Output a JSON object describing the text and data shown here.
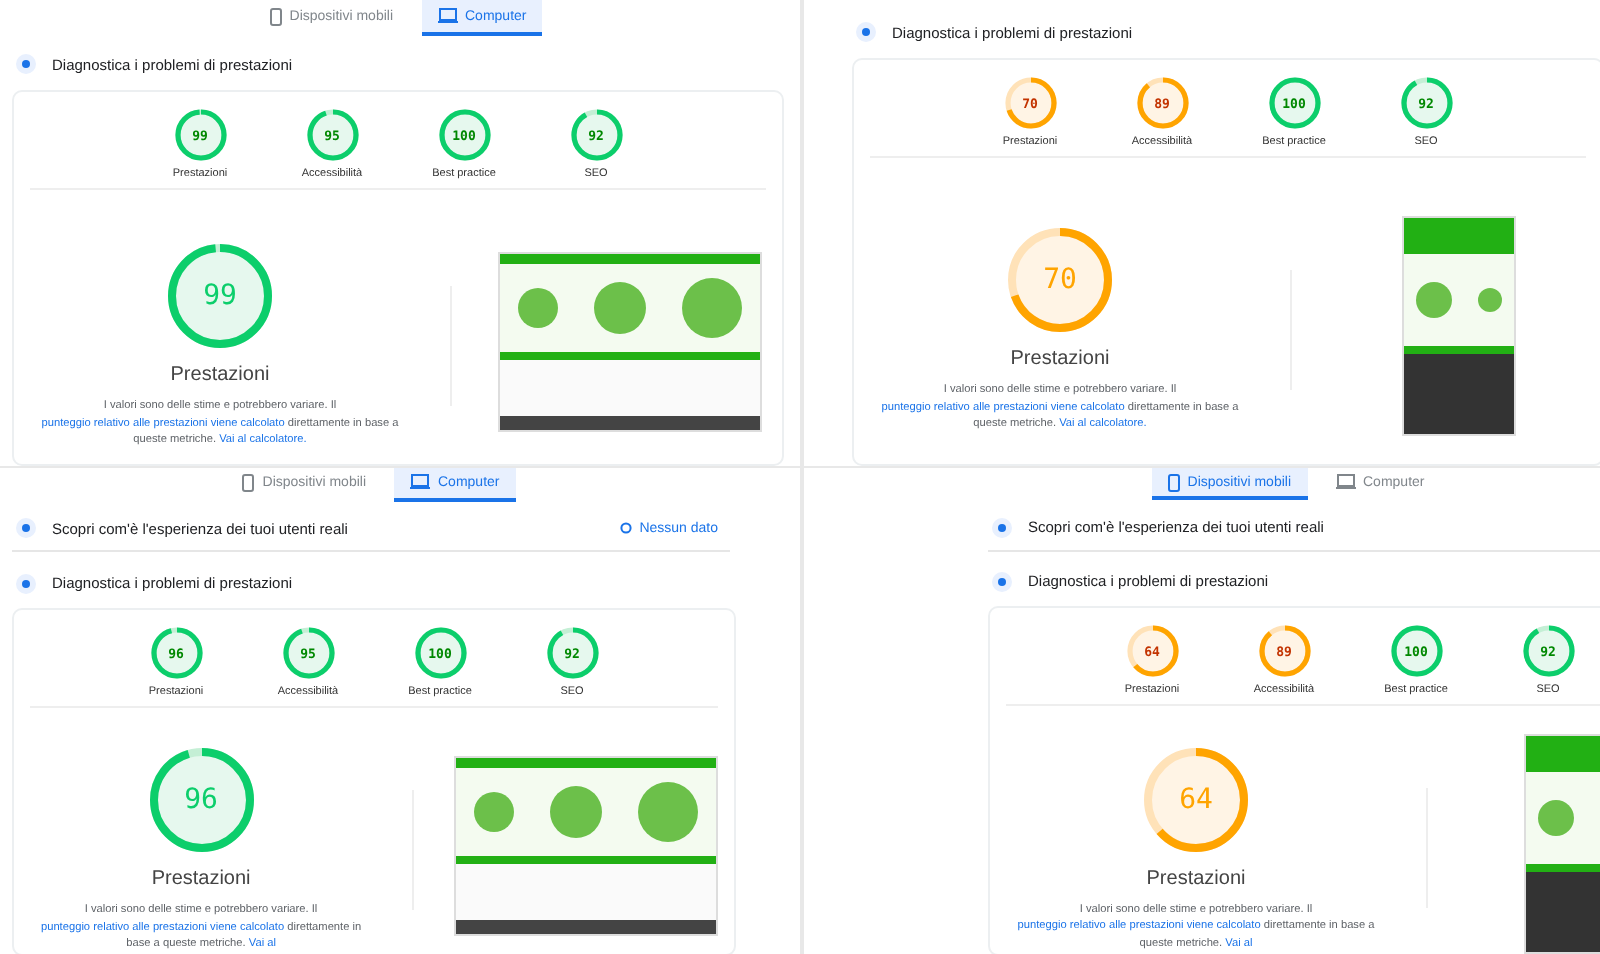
{
  "panels": [
    {
      "preview": {
        "kind": "desktop"
      },
      "tabs": [
        {
          "label": "Dispositivi mobili",
          "kind": "mobile",
          "selected": false
        },
        {
          "label": "Computer",
          "kind": "desktop",
          "selected": true
        }
      ],
      "diagnostics_title": "Diagnostica i problemi di prestazioni",
      "scores": [
        {
          "label": "Prestazioni",
          "value": "99",
          "level": 0.99
        },
        {
          "label": "Accessibilità",
          "value": "95",
          "level": 0.95
        },
        {
          "label": "Best practice",
          "value": "100",
          "level": 1
        },
        {
          "label": "SEO",
          "value": "92",
          "level": 0.92
        }
      ],
      "main_score": {
        "value": "99",
        "level": 0.99,
        "label": "Prestazioni"
      },
      "description": [
        {
          "text": "I valori sono delle stime e potrebbero variare. Il ",
          "kind": "text"
        },
        {
          "text": "punteggio relativo alle prestazioni viene calcolato",
          "kind": "link"
        },
        {
          "text": " direttamente in base a queste metriche. ",
          "kind": "text"
        },
        {
          "text": "Vai al calcolatore.",
          "kind": "link"
        }
      ]
    },
    {
      "preview": {
        "kind": "mobile"
      },
      "diagnostics_title": "Diagnostica i problemi di prestazioni",
      "scores": [
        {
          "label": "Prestazioni",
          "value": "70",
          "level": 0.7
        },
        {
          "label": "Accessibilità",
          "value": "89",
          "level": 0.89
        },
        {
          "label": "Best practice",
          "value": "100",
          "level": 1
        },
        {
          "label": "SEO",
          "value": "92",
          "level": 0.92
        }
      ],
      "main_score": {
        "value": "70",
        "level": 0.7,
        "label": "Prestazioni"
      },
      "description": [
        {
          "text": "I valori sono delle stime e potrebbero variare. Il ",
          "kind": "text"
        },
        {
          "text": "punteggio relativo alle prestazioni viene calcolato",
          "kind": "link"
        },
        {
          "text": " direttamente in base a queste metriche. ",
          "kind": "text"
        },
        {
          "text": "Vai al calcolatore.",
          "kind": "link"
        }
      ]
    },
    {
      "preview": {
        "kind": "desktop"
      },
      "tabs": [
        {
          "label": "Dispositivi mobili",
          "kind": "mobile",
          "selected": false
        },
        {
          "label": "Computer",
          "kind": "desktop",
          "selected": true
        }
      ],
      "field_data": {
        "title": "Scopri com'è l'esperienza dei tuoi utenti reali",
        "status": "Nessun dato"
      },
      "diagnostics_title": "Diagnostica i problemi di prestazioni",
      "scores": [
        {
          "label": "Prestazioni",
          "value": "96",
          "level": 0.96
        },
        {
          "label": "Accessibilità",
          "value": "95",
          "level": 0.95
        },
        {
          "label": "Best practice",
          "value": "100",
          "level": 1
        },
        {
          "label": "SEO",
          "value": "92",
          "level": 0.92
        }
      ],
      "main_score": {
        "value": "96",
        "level": 0.96,
        "label": "Prestazioni"
      },
      "description": [
        {
          "text": "I valori sono delle stime e potrebbero variare. Il ",
          "kind": "text"
        },
        {
          "text": "punteggio relativo alle prestazioni viene calcolato",
          "kind": "link"
        },
        {
          "text": " direttamente in base a queste metriche. ",
          "kind": "text"
        },
        {
          "text": "Vai al",
          "kind": "link"
        }
      ]
    },
    {
      "preview": {
        "kind": "mobile"
      },
      "tabs": [
        {
          "label": "Dispositivi mobili",
          "kind": "mobile",
          "selected": true
        },
        {
          "label": "Computer",
          "kind": "desktop",
          "selected": false
        }
      ],
      "field_data": {
        "title": "Scopri com'è l'esperienza dei tuoi utenti reali"
      },
      "diagnostics_title": "Diagnostica i problemi di prestazioni",
      "scores": [
        {
          "label": "Prestazioni",
          "value": "64",
          "level": 0.64
        },
        {
          "label": "Accessibilità",
          "value": "89",
          "level": 0.89
        },
        {
          "label": "Best practice",
          "value": "100",
          "level": 1
        },
        {
          "label": "SEO",
          "value": "92",
          "level": 0.92
        }
      ],
      "main_score": {
        "value": "64",
        "level": 0.64,
        "label": "Prestazioni"
      },
      "description": [
        {
          "text": "I valori sono delle stime e potrebbero variare. Il ",
          "kind": "text"
        },
        {
          "text": "punteggio relativo alle prestazioni viene calcolato",
          "kind": "link"
        },
        {
          "text": " direttamente in base a queste metriche. ",
          "kind": "text"
        },
        {
          "text": "Vai al",
          "kind": "link"
        }
      ]
    }
  ]
}
